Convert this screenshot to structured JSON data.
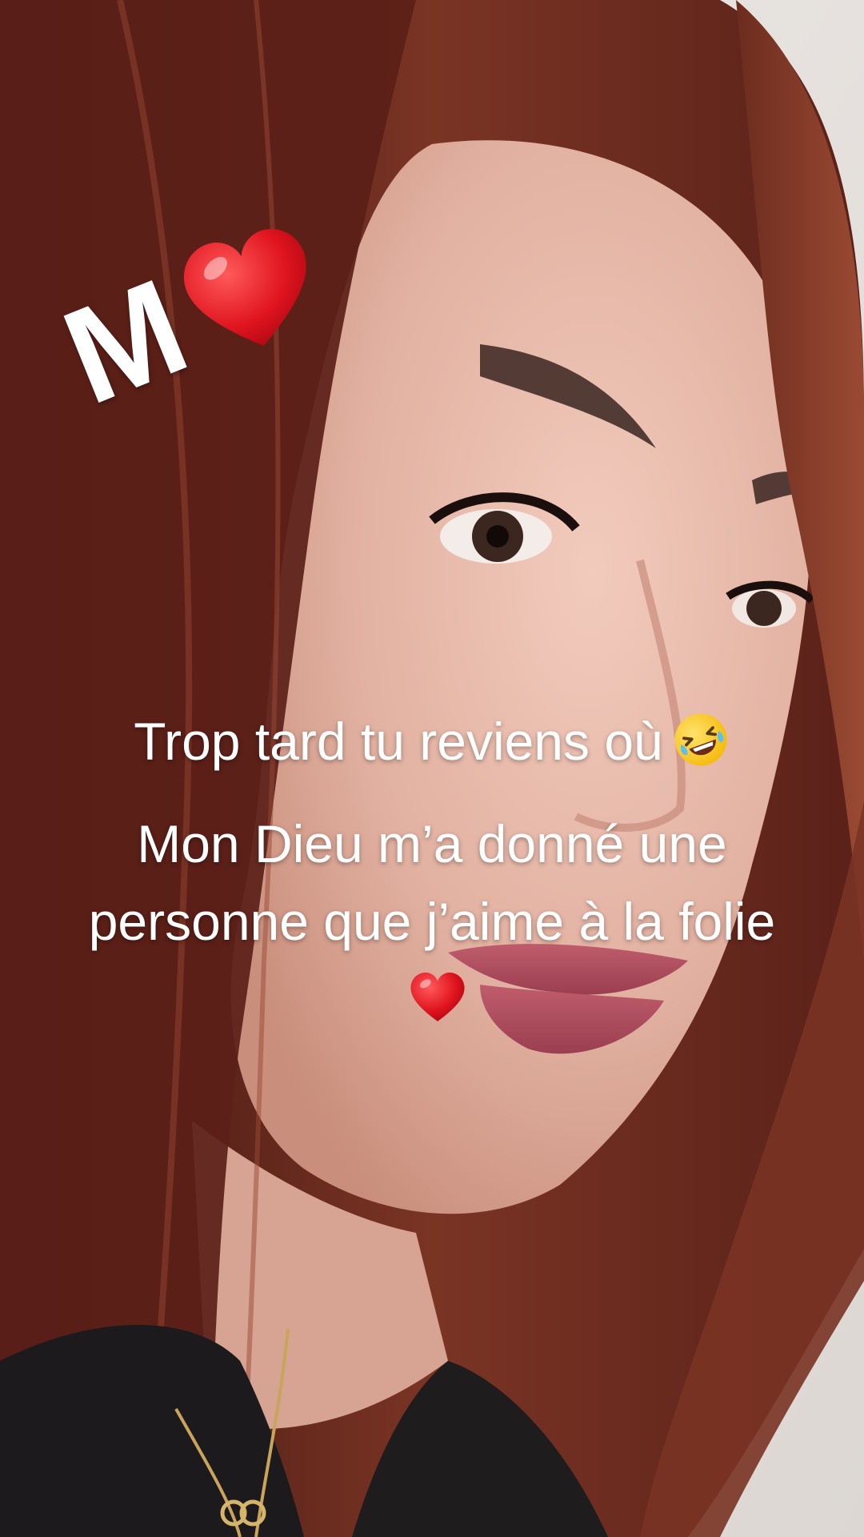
{
  "sticker": {
    "letter": "M",
    "emoji_icon": "red-heart-icon"
  },
  "caption": {
    "line_1": "Trop tard tu reviens où",
    "line_1_emoji_icon": "rolling-laughing-face-icon",
    "line_2": "Mon Dieu m’a donné une personne que j’aime à la folie",
    "line_2_emoji_icon": "red-heart-icon",
    "text_color": "#ffffff"
  },
  "colors": {
    "hair": "#6a2a1f",
    "skin": "#e6b9aa",
    "background_wall": "#e9e4e0",
    "lips": "#a8485a",
    "sweater": "#1c1a1c"
  }
}
